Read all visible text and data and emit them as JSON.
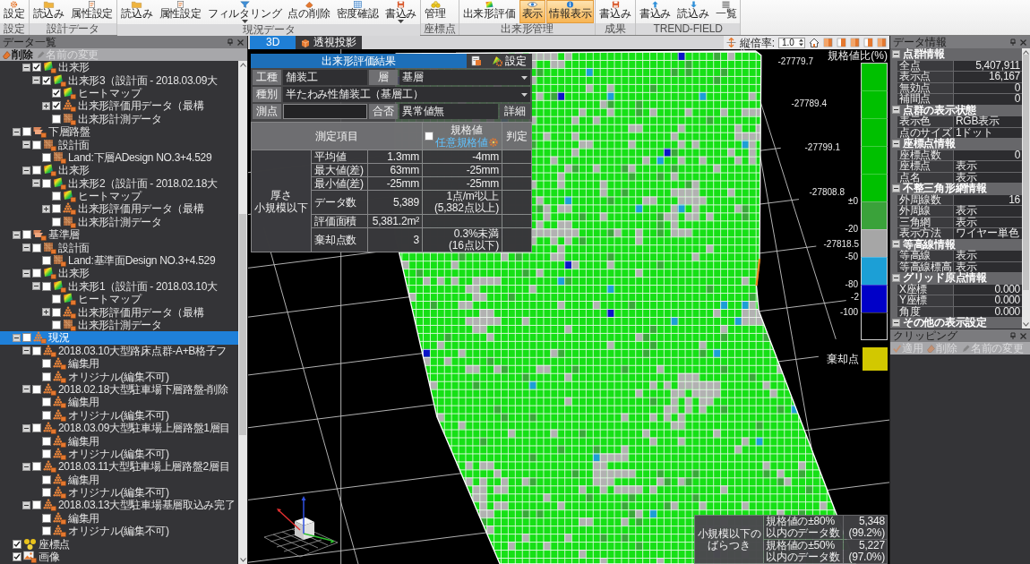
{
  "ribbon": {
    "groups": [
      {
        "label": "設定",
        "buttons": [
          {
            "label": "設定",
            "selected": false,
            "menu": false
          }
        ]
      },
      {
        "label": "設計データ",
        "buttons": [
          {
            "label": "読込み",
            "selected": false,
            "menu": false
          },
          {
            "label": "属性設定",
            "selected": false,
            "menu": false
          }
        ]
      },
      {
        "label": "現況データ",
        "buttons": [
          {
            "label": "読込み",
            "selected": false,
            "menu": false
          },
          {
            "label": "属性設定",
            "selected": false,
            "menu": false
          },
          {
            "label": "フィルタリング",
            "selected": false,
            "menu": true
          },
          {
            "label": "点の削除",
            "selected": false,
            "menu": false
          },
          {
            "label": "密度確認",
            "selected": false,
            "menu": false
          },
          {
            "label": "書込み",
            "selected": false,
            "menu": true
          }
        ]
      },
      {
        "label": "座標点",
        "buttons": [
          {
            "label": "管理",
            "selected": false,
            "menu": false
          }
        ]
      },
      {
        "label": "出来形管理",
        "buttons": [
          {
            "label": "出来形評価",
            "selected": false,
            "menu": false
          },
          {
            "label": "表示",
            "selected": true,
            "menu": false
          },
          {
            "label": "情報表示",
            "selected": true,
            "menu": false
          }
        ]
      },
      {
        "label": "成果",
        "buttons": [
          {
            "label": "書込み",
            "selected": false,
            "menu": false
          }
        ]
      },
      {
        "label": "TREND-FIELD",
        "buttons": [
          {
            "label": "書込み",
            "selected": false,
            "menu": false
          },
          {
            "label": "読込み",
            "selected": false,
            "menu": false
          },
          {
            "label": "一覧",
            "selected": false,
            "menu": false
          }
        ]
      }
    ]
  },
  "data_list": {
    "title": "データ一覧",
    "toolbar": [
      {
        "label": "削除",
        "disabled": false
      },
      {
        "label": "名前の変更",
        "disabled": true
      }
    ],
    "tree": [
      {
        "children": [
          {
            "children": [
              {
                "label": "出来形",
                "kind": "heatmap",
                "checked": true,
                "expanded": true,
                "selected": false,
                "children": [
                  {
                    "label": "出来形3（設計面 - 2018.03.09大",
                    "kind": "heatmap",
                    "checked": true,
                    "expanded": true,
                    "selected": false,
                    "children": [
                      {
                        "label": "ヒートマップ",
                        "kind": "heatmap",
                        "checked": true,
                        "selected": false
                      },
                      {
                        "label": "出来形評価用データ（最構",
                        "kind": "points",
                        "checked": true,
                        "expanded": false,
                        "selected": false
                      },
                      {
                        "label": "出来形計測データ",
                        "kind": "surface",
                        "checked": false,
                        "selected": false
                      }
                    ]
                  }
                ]
              }
            ]
          },
          {
            "label": "下層路盤",
            "kind": "layer",
            "checked": false,
            "expanded": true,
            "selected": false,
            "children": [
              {
                "label": "設計面",
                "kind": "surface",
                "checked": false,
                "expanded": true,
                "selected": false,
                "children": [
                  {
                    "label": "Land:下層ADesign NO.3+4.529",
                    "kind": "surface",
                    "checked": false,
                    "selected": false
                  }
                ]
              },
              {
                "label": "出来形",
                "kind": "heatmap",
                "checked": false,
                "expanded": true,
                "selected": false,
                "children": [
                  {
                    "label": "出来形2（設計面 - 2018.02.18大",
                    "kind": "heatmap",
                    "checked": false,
                    "expanded": true,
                    "selected": false,
                    "children": [
                      {
                        "label": "ヒートマップ",
                        "kind": "heatmap",
                        "checked": false,
                        "selected": false
                      },
                      {
                        "label": "出来形評価用データ（最構",
                        "kind": "points",
                        "checked": false,
                        "expanded": false,
                        "selected": false
                      },
                      {
                        "label": "出来形計測データ",
                        "kind": "surface",
                        "checked": false,
                        "selected": false
                      }
                    ]
                  }
                ]
              }
            ]
          },
          {
            "label": "基準層",
            "kind": "layer",
            "checked": false,
            "expanded": true,
            "selected": false,
            "children": [
              {
                "label": "設計面",
                "kind": "surface",
                "checked": false,
                "expanded": true,
                "selected": false,
                "children": [
                  {
                    "label": "Land:基準面Design NO.3+4.529",
                    "kind": "surface",
                    "checked": false,
                    "selected": false
                  }
                ]
              },
              {
                "label": "出来形",
                "kind": "heatmap",
                "checked": false,
                "expanded": true,
                "selected": false,
                "children": [
                  {
                    "label": "出来形1（設計面 - 2018.03.10大",
                    "kind": "heatmap",
                    "checked": false,
                    "expanded": true,
                    "selected": false,
                    "children": [
                      {
                        "label": "ヒートマップ",
                        "kind": "heatmap",
                        "checked": false,
                        "selected": false
                      },
                      {
                        "label": "出来形評価用データ（最構",
                        "kind": "points",
                        "checked": false,
                        "expanded": false,
                        "selected": false
                      },
                      {
                        "label": "出来形計測データ",
                        "kind": "surface",
                        "checked": false,
                        "selected": false
                      }
                    ]
                  }
                ]
              }
            ]
          },
          {
            "label": "現況",
            "kind": "points",
            "checked": false,
            "expanded": true,
            "selected": true,
            "children": [
              {
                "label": "2018.03.10大型路床点群-A+B格子フ",
                "kind": "points",
                "checked": false,
                "expanded": true,
                "selected": false,
                "children": [
                  {
                    "label": "編集用",
                    "kind": "points",
                    "checked": false,
                    "selected": false
                  },
                  {
                    "label": "オリジナル(編集不可)",
                    "kind": "points",
                    "checked": false,
                    "selected": false
                  }
                ]
              },
              {
                "label": "2018.02.18大型駐車場下層路盤-削除",
                "kind": "points",
                "checked": false,
                "expanded": true,
                "selected": false,
                "children": [
                  {
                    "label": "編集用",
                    "kind": "points",
                    "checked": false,
                    "selected": false
                  },
                  {
                    "label": "オリジナル(編集不可)",
                    "kind": "points",
                    "checked": false,
                    "selected": false
                  }
                ]
              },
              {
                "label": "2018.03.09大型駐車場上層路盤1層目",
                "kind": "points",
                "checked": false,
                "expanded": true,
                "selected": false,
                "children": [
                  {
                    "label": "編集用",
                    "kind": "points",
                    "checked": false,
                    "selected": false
                  },
                  {
                    "label": "オリジナル(編集不可)",
                    "kind": "points",
                    "checked": false,
                    "selected": false
                  }
                ]
              },
              {
                "label": "2018.03.11大型駐車場上層路盤2層目",
                "kind": "points",
                "checked": false,
                "expanded": true,
                "selected": false,
                "children": [
                  {
                    "label": "編集用",
                    "kind": "points",
                    "checked": false,
                    "selected": false
                  },
                  {
                    "label": "オリジナル(編集不可)",
                    "kind": "points",
                    "checked": false,
                    "selected": false
                  }
                ]
              },
              {
                "label": "2018.03.13大型駐車場基層取込み完了",
                "kind": "points",
                "checked": false,
                "expanded": true,
                "selected": false,
                "children": [
                  {
                    "label": "編集用",
                    "kind": "points",
                    "checked": false,
                    "selected": false
                  },
                  {
                    "label": "オリジナル(編集不可)",
                    "kind": "points",
                    "checked": false,
                    "selected": false
                  }
                ]
              }
            ]
          }
        ]
      },
      {
        "label": "座標点",
        "kind": "coords",
        "checked": true,
        "selected": false
      },
      {
        "label": "画像",
        "kind": "image",
        "checked": true,
        "selected": false
      }
    ]
  },
  "view": {
    "tabs": [
      {
        "label": "3D",
        "selected": true
      },
      {
        "label": "透視投影",
        "selected": false
      }
    ],
    "scale_label": "縦倍率:",
    "scale_value": "1.0",
    "evaluation": {
      "title": "出来形評価結果",
      "settings": "設定",
      "work_type_label": "工種",
      "work_type": "舗装工",
      "layer_label": "層",
      "layer": "基層",
      "category_label": "種別",
      "category": "半たわみ性舗装工（基層工）",
      "station_label": "測点",
      "result_label": "合否",
      "result": "異常値無",
      "details": "詳細",
      "item_header": "測定項目",
      "spec_header": "規格値",
      "custom_spec": {
        "label": "任意規格値",
        "checked": false
      },
      "judgement_header": "判定",
      "group": [
        "厚さ",
        "小規模以下"
      ],
      "rows": [
        {
          "item": "平均値",
          "value": "1.3mm",
          "spec": "-4mm"
        },
        {
          "item": "最大値(差)",
          "value": "63mm",
          "spec": "-25mm"
        },
        {
          "item": "最小値(差)",
          "value": "-25mm",
          "spec": "-25mm"
        },
        {
          "item": "データ数",
          "value": "5,389",
          "spec": "1点/m²以上\n(5,382点以上)"
        },
        {
          "item": "評価面積",
          "value": "5,381.2m²"
        },
        {
          "item": "棄却点数",
          "value": "3",
          "spec": "0.3%未満\n(16点以下)"
        }
      ]
    },
    "axis_labels": [
      "-27779.7",
      "-27789.4",
      "-27799.1",
      "-27808.8",
      "-27818.5",
      "-2"
    ],
    "legend": {
      "title": "規格値比(%)",
      "segments": [
        {
          "color": "#00c000"
        },
        {
          "color": "#00c000"
        },
        {
          "color": "#00c000"
        },
        {
          "color": "#00c000"
        },
        {
          "color": "#00c000",
          "label": "±0"
        },
        {
          "color": "#3aa23a",
          "label": "-20"
        },
        {
          "color": "#a6a6a6",
          "label": "-50"
        },
        {
          "color": "#1c9fd6",
          "label": "-80"
        },
        {
          "color": "#0000c8",
          "label": "-100"
        },
        {
          "color": "#000000"
        }
      ],
      "reject": {
        "label": "棄却点",
        "color": "#d2c800"
      }
    },
    "variation": {
      "label": [
        "小規模以下の",
        "ばらつき"
      ],
      "rows": [
        {
          "label": "規格値の±80%\n以内のデータ数",
          "value": "5,348\n(99.2%)"
        },
        {
          "label": "規格値の±50%\n以内のデータ数",
          "value": "5,227\n(97.0%)"
        }
      ]
    }
  },
  "data_info": {
    "title": "データ情報",
    "sections": [
      {
        "title": "点群情報",
        "expanded": true,
        "rows": [
          {
            "name": "全点",
            "value": "5,407,911",
            "kind": "number"
          },
          {
            "name": "表示点",
            "value": "16,167",
            "kind": "number"
          },
          {
            "name": "無効点",
            "value": "0",
            "kind": "number"
          },
          {
            "name": "補間点",
            "value": "0",
            "kind": "number"
          }
        ]
      },
      {
        "title": "点群の表示状態",
        "expanded": true,
        "rows": [
          {
            "name": "表示色",
            "value": "RGB表示",
            "kind": "text"
          },
          {
            "name": "点のサイズ",
            "value": "1ドット",
            "kind": "text"
          }
        ]
      },
      {
        "title": "座標点情報",
        "expanded": true,
        "rows": [
          {
            "name": "座標点数",
            "value": "0",
            "kind": "number"
          },
          {
            "name": "座標点",
            "value": "表示",
            "kind": "text"
          },
          {
            "name": "点名",
            "value": "表示",
            "kind": "text"
          }
        ]
      },
      {
        "title": "不整三角形網情報",
        "expanded": true,
        "rows": [
          {
            "name": "外周線数",
            "value": "16",
            "kind": "number"
          },
          {
            "name": "外周線",
            "value": "表示",
            "kind": "text"
          },
          {
            "name": "三角網",
            "value": "表示",
            "kind": "text"
          },
          {
            "name": "表示方法",
            "value": "ワイヤー単色",
            "kind": "text"
          }
        ]
      },
      {
        "title": "等高線情報",
        "expanded": true,
        "rows": [
          {
            "name": "等高線",
            "value": "表示",
            "kind": "text"
          },
          {
            "name": "等高線標高",
            "value": "表示",
            "kind": "text"
          }
        ]
      },
      {
        "title": "グリッド原点情報",
        "expanded": true,
        "rows": [
          {
            "name": "X座標",
            "value": "0.000",
            "kind": "number"
          },
          {
            "name": "Y座標",
            "value": "0.000",
            "kind": "number"
          },
          {
            "name": "角度",
            "value": "0.000",
            "kind": "number"
          }
        ]
      },
      {
        "title": "その他の表示設定",
        "expanded": true
      }
    ]
  },
  "clipping": {
    "title": "クリッピング",
    "toolbar": [
      {
        "label": "適用",
        "disabled": true
      },
      {
        "label": "削除",
        "disabled": true
      },
      {
        "label": "名前の変更",
        "disabled": true
      }
    ]
  }
}
